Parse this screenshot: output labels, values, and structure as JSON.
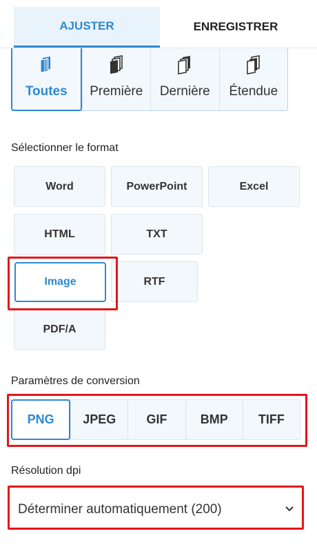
{
  "tabs": [
    {
      "label": "AJUSTER",
      "active": true
    },
    {
      "label": "ENREGISTRER",
      "active": false
    }
  ],
  "page_range": {
    "items": [
      {
        "label": "Toutes",
        "icon": "all-pages-icon",
        "active": true
      },
      {
        "label": "Première",
        "icon": "first-page-icon",
        "active": false
      },
      {
        "label": "Dernière",
        "icon": "last-page-icon",
        "active": false
      },
      {
        "label": "Étendue",
        "icon": "range-pages-icon",
        "active": false
      }
    ]
  },
  "format": {
    "title": "Sélectionner le format",
    "options": [
      "Word",
      "PowerPoint",
      "Excel",
      "HTML",
      "TXT",
      "Image",
      "RTF",
      "PDF/A"
    ],
    "selected": "Image"
  },
  "conversion": {
    "title": "Paramètres de conversion",
    "options": [
      "PNG",
      "JPEG",
      "GIF",
      "BMP",
      "TIFF"
    ],
    "selected": "PNG"
  },
  "resolution": {
    "title": "Résolution dpi",
    "value": "Déterminer automatiquement (200)"
  },
  "colors": {
    "accent": "#2d89d2",
    "highlight": "#e2161a",
    "button_bg": "#f3f8fc"
  }
}
